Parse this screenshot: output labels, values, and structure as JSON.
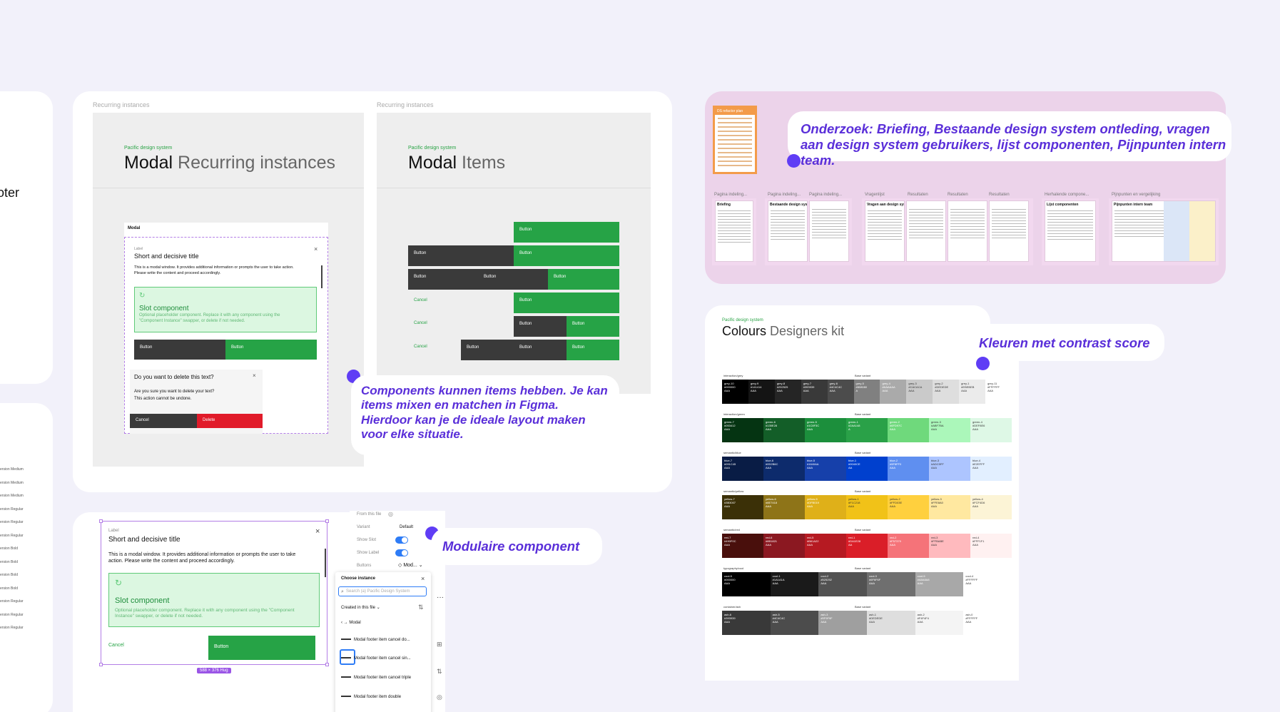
{
  "left": {
    "fragment": "oter",
    "list": [
      "ersion Medium",
      "ersion Medium",
      "ersion Medium",
      "ersion Regular",
      "ersion Regular",
      "ersion Regular",
      "ersion Bold",
      "ersion Bold",
      "ersion Bold",
      "ersion Bold",
      "ersion Regular",
      "ersion Regular",
      "ersion Regular"
    ]
  },
  "recurring": {
    "frame_label_left": "Recurring instances",
    "frame_label_right": "Recurring instances",
    "ds_tag": "Pacific design system",
    "left_title_bold": "Modal",
    "left_title_light": "Recurring instances",
    "right_title_bold": "Modal",
    "right_title_light": "Items",
    "modal_header": "Modal",
    "modal_label": "Label",
    "modal_title": "Short and decisive title",
    "modal_body": "This is a modal window. It provides additional information or prompts the user to take action. Please write the content and proceed accordingly.",
    "slot_title": "Slot component",
    "slot_desc": "Optional placeholder component. Replace it with any component using the \"Component Instance\" swapper, or delete if not needed.",
    "button": "Button",
    "cancel": "Cancel",
    "delete": "Delete",
    "delete_question": "Do you want to delete this text?",
    "delete_body_1": "Are you sure you want to delete your text?",
    "delete_body_2": "This action cannot be undone.",
    "close": "×"
  },
  "notes": {
    "components": "Components kunnen items hebben. Je kan items mixen en matchen in Figma. Hierdoor kan je de ideale layout maken voor elke situatie.",
    "onderzoek": "Onderzoek: Briefing, Bestaande design system ontleding, vragen aan design system gebruikers, lijst componenten, Pijnpunten intern team.",
    "kleuren": "Kleuren met contrast score",
    "modulaire": "Modulaire component"
  },
  "research": {
    "orange_doc": "DS refactor plan",
    "groups": [
      {
        "label": "Pagina indeling...",
        "title": "Briefing"
      },
      {
        "label": "Pagina indeling...",
        "label2": "Pagina indeling...",
        "title": "Bestaande design system ontleding"
      },
      {
        "label": "Vragenlijst",
        "label2": "Resultaten",
        "label3": "Resultaten",
        "label4": "Resultaten",
        "title": "Vragen aan design system gebruikers"
      },
      {
        "label": "Herhalende compone...",
        "title": "Lijst componenten"
      },
      {
        "label": "Pijnpunten en vergelijking",
        "title": "Pijnpunten intern team"
      }
    ]
  },
  "colours": {
    "ds_tag": "Pacific design system",
    "title_bold": "Colours",
    "title_light": "Designers kit",
    "base_variant": "Base variant",
    "groups": [
      {
        "name": "interaction/grey",
        "swatches": [
          {
            "name": "grey-10",
            "hex": "#000000",
            "score": "AAA",
            "color": "#000000",
            "fg": "#fff"
          },
          {
            "name": "grey-9",
            "hex": "#141414",
            "score": "AAA",
            "color": "#141414",
            "fg": "#fff"
          },
          {
            "name": "grey-8",
            "hex": "#252525",
            "score": "AAA",
            "color": "#252525",
            "fg": "#fff"
          },
          {
            "name": "grey-7",
            "hex": "#393939",
            "score": "AAA",
            "color": "#393939",
            "fg": "#fff"
          },
          {
            "name": "grey-6",
            "hex": "#4C4C4C",
            "score": "AAA",
            "color": "#4c4c4c",
            "fg": "#fff"
          },
          {
            "name": "grey-5",
            "hex": "#808080",
            "score": "A",
            "color": "#808080",
            "fg": "#fff"
          },
          {
            "name": "grey-4",
            "hex": "#AAAAAA",
            "score": "AAA",
            "color": "#aaaaaa",
            "fg": "#fff"
          },
          {
            "name": "grey-3",
            "hex": "#CACACA",
            "score": "AAA",
            "color": "#cacaca",
            "fg": "#333"
          },
          {
            "name": "grey-2",
            "hex": "#DEDEDE",
            "score": "AAA",
            "color": "#dedede",
            "fg": "#333"
          },
          {
            "name": "grey-1",
            "hex": "#EBEBEB",
            "score": "AAA",
            "color": "#ebebeb",
            "fg": "#333"
          },
          {
            "name": "grey-11",
            "hex": "#FFFFFF",
            "score": "AAA",
            "color": "#ffffff",
            "fg": "#333"
          }
        ]
      },
      {
        "name": "interaction/green",
        "swatches": [
          {
            "name": "green-7",
            "hex": "#053412",
            "score": "AAA",
            "color": "#053412",
            "fg": "#fff"
          },
          {
            "name": "green-6",
            "hex": "#135E28",
            "score": "AAA",
            "color": "#135e28",
            "fg": "#fff"
          },
          {
            "name": "green-5",
            "hex": "#1C8F3C",
            "score": "AAA",
            "color": "#1c8f3c",
            "fg": "#fff"
          },
          {
            "name": "green-1",
            "hex": "#2AA148",
            "score": "A",
            "color": "#2aa148",
            "fg": "#fff"
          },
          {
            "name": "green-2",
            "hex": "#6FD97C",
            "score": "AAA",
            "color": "#6fd97c",
            "fg": "#fff"
          },
          {
            "name": "green-3",
            "hex": "#ABF7BA",
            "score": "AAA",
            "color": "#abf7ba",
            "fg": "#333"
          },
          {
            "name": "green-4",
            "hex": "#DEF8E6",
            "score": "AAA",
            "color": "#def8e6",
            "fg": "#333"
          }
        ]
      },
      {
        "name": "semantic/blue",
        "swatches": [
          {
            "name": "blue-7",
            "hex": "#091C45",
            "score": "AAA",
            "color": "#091c45",
            "fg": "#fff"
          },
          {
            "name": "blue-6",
            "hex": "#0D2B6C",
            "score": "AAA",
            "color": "#0d2b6c",
            "fg": "#fff"
          },
          {
            "name": "blue-5",
            "hex": "#1640AA",
            "score": "AAA",
            "color": "#1640aa",
            "fg": "#fff"
          },
          {
            "name": "blue-1",
            "hex": "#0040CE",
            "score": "AA",
            "color": "#0040ce",
            "fg": "#fff"
          },
          {
            "name": "blue-2",
            "hex": "#5F8FF0",
            "score": "AAA",
            "color": "#5f8ff0",
            "fg": "#fff"
          },
          {
            "name": "blue-3",
            "hex": "#ADC5FF",
            "score": "AAA",
            "color": "#adc5ff",
            "fg": "#333"
          },
          {
            "name": "blue-4",
            "hex": "#E2EFFF",
            "score": "AAA",
            "color": "#e2efff",
            "fg": "#333"
          }
        ]
      },
      {
        "name": "semantic/yellow",
        "swatches": [
          {
            "name": "yellow-7",
            "hex": "#3B3007",
            "score": "AAA",
            "color": "#3b3007",
            "fg": "#fff"
          },
          {
            "name": "yellow-6",
            "hex": "#8E7418",
            "score": "AAA",
            "color": "#8e7418",
            "fg": "#fff"
          },
          {
            "name": "yellow-5",
            "hex": "#DFB019",
            "score": "AAA",
            "color": "#dfb019",
            "fg": "#fff"
          },
          {
            "name": "yellow-1",
            "hex": "#F1C218",
            "score": "AAA",
            "color": "#f1c218",
            "fg": "#333"
          },
          {
            "name": "yellow-2",
            "hex": "#FFD03E",
            "score": "AAA",
            "color": "#ffd03e",
            "fg": "#333"
          },
          {
            "name": "yellow-3",
            "hex": "#FFE8A0",
            "score": "AAA",
            "color": "#ffe8a0",
            "fg": "#333"
          },
          {
            "name": "yellow-4",
            "hex": "#FCF4D6",
            "score": "AAA",
            "color": "#fcf4d6",
            "fg": "#333"
          }
        ]
      },
      {
        "name": "semantic/red",
        "swatches": [
          {
            "name": "red-7",
            "hex": "#490F0C",
            "score": "AAA",
            "color": "#490f0c",
            "fg": "#fff"
          },
          {
            "name": "red-6",
            "hex": "#8B1821",
            "score": "AAA",
            "color": "#8b1821",
            "fg": "#fff"
          },
          {
            "name": "red-5",
            "hex": "#B61A22",
            "score": "AAA",
            "color": "#b61a22",
            "fg": "#fff"
          },
          {
            "name": "red-1",
            "hex": "#DA1E28",
            "score": "AA",
            "color": "#da1e28",
            "fg": "#fff"
          },
          {
            "name": "red-2",
            "hex": "#F57379",
            "score": "AAA",
            "color": "#f57379",
            "fg": "#fff"
          },
          {
            "name": "red-3",
            "hex": "#FFBABE",
            "score": "AAA",
            "color": "#ffbabe",
            "fg": "#333"
          },
          {
            "name": "red-4",
            "hex": "#FFF1F1",
            "score": "AAA",
            "color": "#fff1f1",
            "fg": "#333"
          }
        ]
      },
      {
        "name": "typography/cool",
        "swatches": [
          {
            "name": "cool-5",
            "hex": "#000000",
            "score": "AAA",
            "color": "#000000",
            "fg": "#fff"
          },
          {
            "name": "cool-1",
            "hex": "#1A1A1A",
            "score": "AAA",
            "color": "#1a1a1a",
            "fg": "#fff"
          },
          {
            "name": "cool-2",
            "hex": "#525252",
            "score": "AAA",
            "color": "#525252",
            "fg": "#fff"
          },
          {
            "name": "cool-3",
            "hex": "#6F6F6F",
            "score": "AAA",
            "color": "#6f6f6f",
            "fg": "#fff"
          },
          {
            "name": "cool-5",
            "hex": "#A8A8A8",
            "score": "AAA",
            "color": "#a8a8a8",
            "fg": "#fff"
          },
          {
            "name": "cool-4",
            "hex": "#FFFFFF",
            "score": "AAA",
            "color": "#ffffff",
            "fg": "#333"
          }
        ]
      },
      {
        "name": "container/ash",
        "swatches": [
          {
            "name": "ash-6",
            "hex": "#393939",
            "score": "AAA",
            "color": "#393939",
            "fg": "#fff"
          },
          {
            "name": "ash-5",
            "hex": "#4C4C4C",
            "score": "AAA",
            "color": "#4c4c4c",
            "fg": "#fff"
          },
          {
            "name": "ash-3",
            "hex": "#9F9F9F",
            "score": "AAA",
            "color": "#9f9f9f",
            "fg": "#fff"
          },
          {
            "name": "ash-1",
            "hex": "#DEDEDE",
            "score": "AAA",
            "color": "#dedede",
            "fg": "#333"
          },
          {
            "name": "ash-2",
            "hex": "#F4F4F4",
            "score": "AAA",
            "color": "#f4f4f4",
            "fg": "#333"
          },
          {
            "name": "ash-0",
            "hex": "#FFFFFF",
            "score": "AAA",
            "color": "#ffffff",
            "fg": "#333"
          }
        ]
      }
    ]
  },
  "modular": {
    "label": "Label",
    "title": "Short and decisive title",
    "body": "This is a modal window. It provides additional information or prompts the user to take action. Please write the content and proceed accordingly.",
    "slot_title": "Slot component",
    "slot_desc": "Optional placeholder component. Replace it with any component using the \"Component Instance\" swapper, or delete if not needed.",
    "cancel": "Cancel",
    "button": "Button",
    "close": "×",
    "hug": "588 × 376 Hug"
  },
  "props": {
    "from_file": "From this file",
    "variant_label": "Variant",
    "variant_value": "Default",
    "show_slot": "Show Slot",
    "show_label": "Show Label",
    "buttons_label": "Buttons",
    "buttons_value": "Mod...",
    "more": "···"
  },
  "choose": {
    "title": "Choose instance",
    "search_placeholder": "Search (a) Pacific Design System",
    "filter": "Created in this file",
    "breadcrumb": "Modal",
    "items": [
      "Modal footer item cancel do...",
      "Modal footer item cancel sin...",
      "Modal footer item cancel triple",
      "Modal footer item double"
    ],
    "close": "×"
  }
}
